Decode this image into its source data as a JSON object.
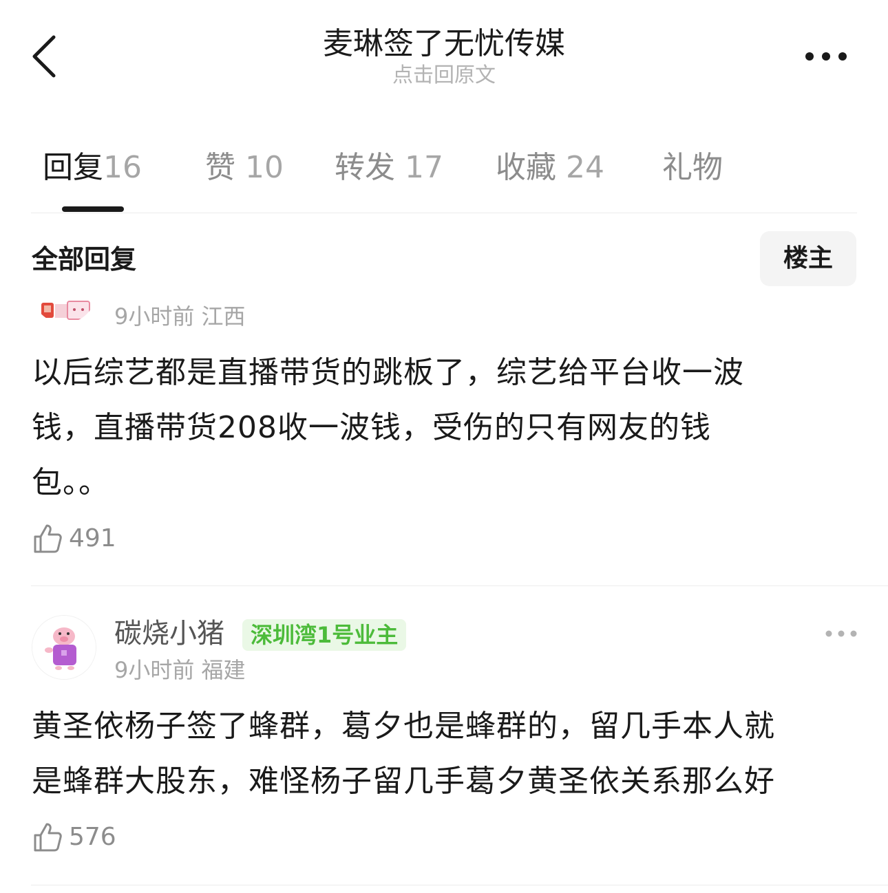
{
  "header": {
    "title": "麦琳签了无忧传媒",
    "subtitle": "点击回原文"
  },
  "tabs": [
    {
      "label": "回复",
      "count": "16",
      "active": true
    },
    {
      "label": "赞",
      "count": "10",
      "active": false
    },
    {
      "label": "转发",
      "count": "17",
      "active": false
    },
    {
      "label": "收藏",
      "count": "24",
      "active": false
    },
    {
      "label": "礼物",
      "count": "",
      "active": false
    }
  ],
  "section": {
    "title": "全部回复",
    "filter_label": "楼主"
  },
  "comments": [
    {
      "meta": "9小时前 江西",
      "lines": [
        "以后综艺都是直播带货的跳板了，综艺给平台收一波",
        "钱，直播带货208收一波钱，受伤的只有网友的钱",
        "包。。"
      ],
      "likes": "491"
    },
    {
      "username": "碳烧小猪",
      "badge": "深圳湾1号业主",
      "meta": "9小时前 福建",
      "lines": [
        "黄圣依杨子签了蜂群，葛夕也是蜂群的，留几手本人就",
        "是蜂群大股东，难怪杨子留几手葛夕黄圣依关系那么好"
      ],
      "likes": "576"
    }
  ],
  "colors": {
    "badge_text": "#4cbb3a",
    "badge_bg": "#eaf8e6",
    "muted": "#a6a6a6"
  }
}
